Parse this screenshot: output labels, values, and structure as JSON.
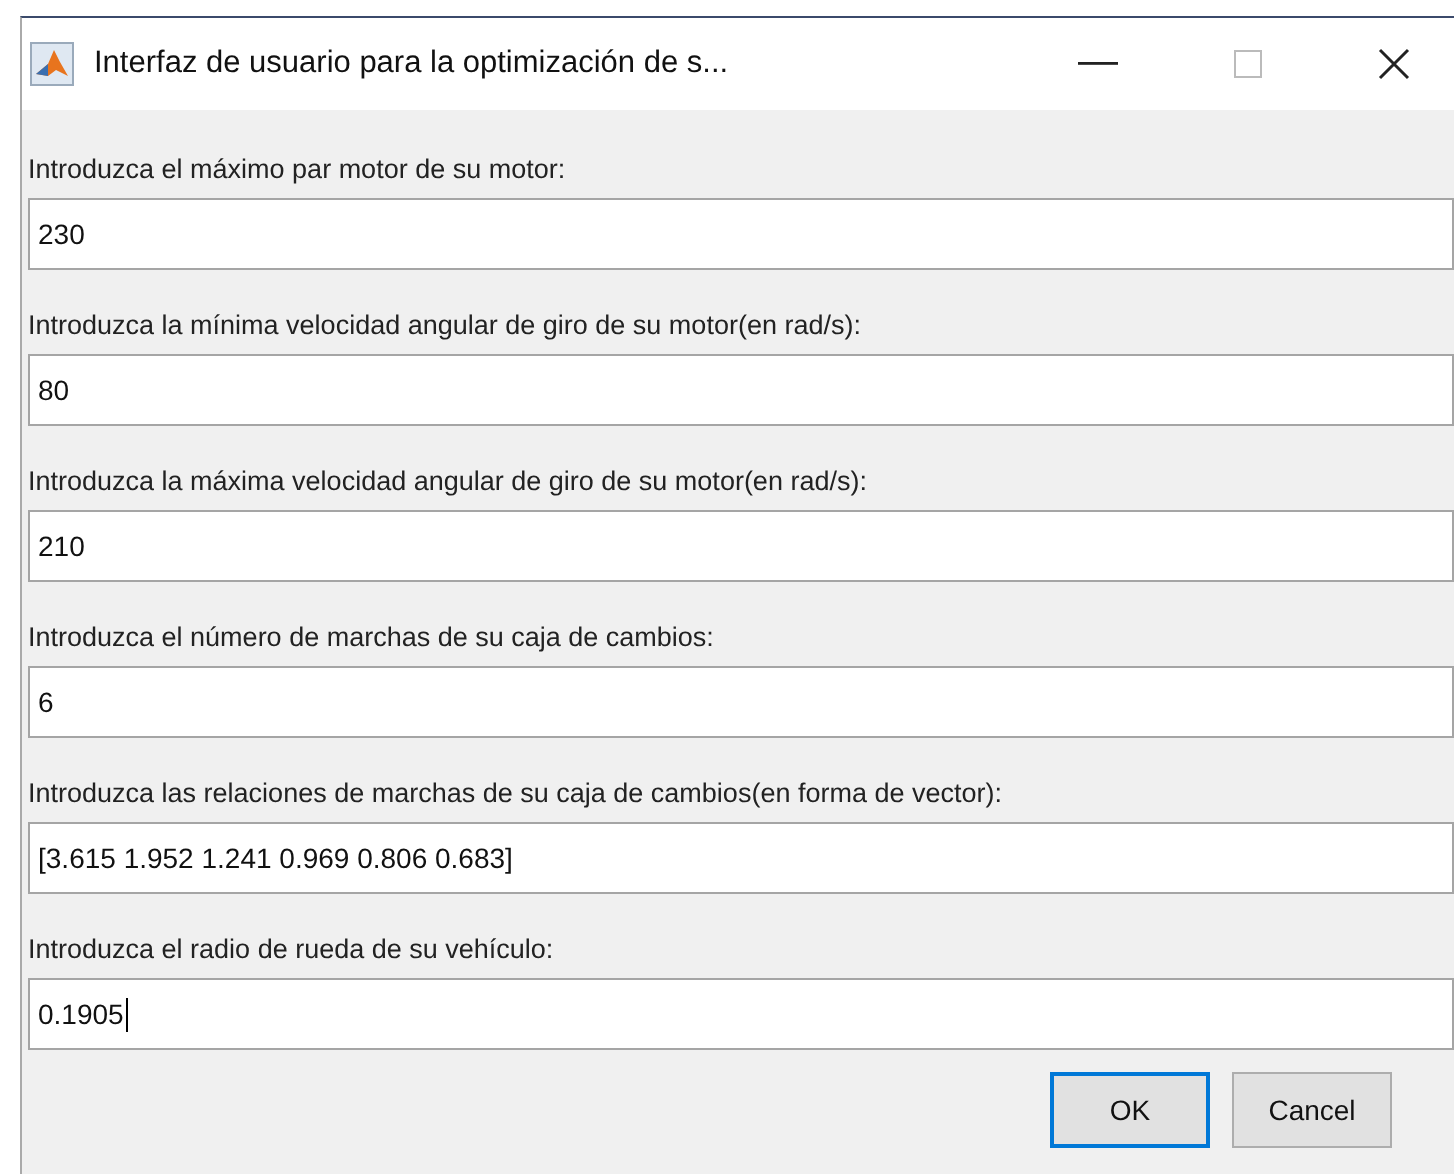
{
  "window": {
    "title": "Interfaz de usuario para la optimización de s..."
  },
  "prompts": [
    {
      "label": "Introduzca el máximo par motor de su motor:",
      "value": "230",
      "focused": false
    },
    {
      "label": "Introduzca la mínima velocidad angular de giro de su motor(en rad/s):",
      "value": "80",
      "focused": false
    },
    {
      "label": "Introduzca la máxima velocidad angular de giro de su motor(en rad/s):",
      "value": "210",
      "focused": false
    },
    {
      "label": "Introduzca el número de marchas de su caja de cambios:",
      "value": "6",
      "focused": false
    },
    {
      "label": "Introduzca las relaciones de marchas de su caja de cambios(en forma de vector):",
      "value": "[3.615 1.952 1.241 0.969 0.806 0.683]",
      "focused": false
    },
    {
      "label": "Introduzca el radio de rueda de su vehículo:",
      "value": "0.1905",
      "focused": true
    }
  ],
  "buttons": [
    {
      "label": "OK",
      "default": true
    },
    {
      "label": "Cancel",
      "default": false
    }
  ]
}
